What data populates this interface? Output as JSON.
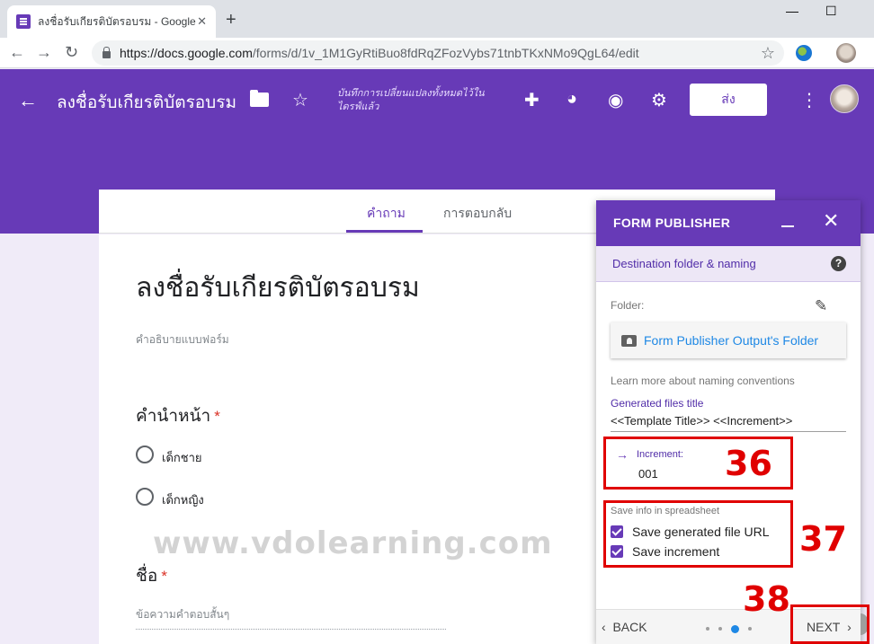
{
  "browser": {
    "tab_title": "ลงชื่อรับเกียรติบัตรอบรม - Google ฟอร์ม",
    "tab_close": "✕",
    "new_tab": "+",
    "url_host": "https://docs.google.com",
    "url_path": "/forms/d/1v_1M1GyRtiBuo8fdRqZFozVybs71tnbTKxNMo9QgL64/edit",
    "window_min": "—",
    "window_max": "☐"
  },
  "forms_header": {
    "form_name": "ลงชื่อรับเกียรติบัตรอบรม",
    "saved_note": "บันทึกการเปลี่ยนแปลงทั้งหมดไว้ในไดรฟ์แล้ว",
    "send_label": "ส่ง"
  },
  "editor_tabs": {
    "questions": "คำถาม",
    "responses": "การตอบกลับ"
  },
  "form": {
    "title": "ลงชื่อรับเกียรติบัตรอบรม",
    "description_placeholder": "คำอธิบายแบบฟอร์ม",
    "q1_label": "คำนำหน้า",
    "q1_options": [
      "เด็กชาย",
      "เด็กหญิง"
    ],
    "q2_label": "ชื่อ",
    "q2_placeholder": "ข้อความคำตอบสั้นๆ",
    "required_mark": "*"
  },
  "watermark": "www.vdolearning.com",
  "publisher_panel": {
    "title": "FORM PUBLISHER",
    "close": "✕",
    "step_title": "Destination folder & naming",
    "help": "?",
    "folder_label": "Folder:",
    "folder_button": "Form Publisher Output's Folder",
    "naming_link": "Learn more about naming conventions",
    "generated_title_label": "Generated files title",
    "generated_title_value": "<<Template Title>> <<Increment>>",
    "increment_label": "Increment:",
    "increment_value": "001",
    "save_info_label": "Save info in spreadsheet",
    "checkbox_url": "Save generated file URL",
    "checkbox_increment": "Save increment",
    "back_label": "BACK",
    "next_label": "NEXT",
    "current_step": 3,
    "total_steps": 4
  },
  "annotations": {
    "num_36": "36",
    "num_37": "37",
    "num_38": "38"
  },
  "colors": {
    "brand_purple": "#673ab7",
    "annotation_red": "#e00000",
    "link_blue": "#1e88e5"
  }
}
